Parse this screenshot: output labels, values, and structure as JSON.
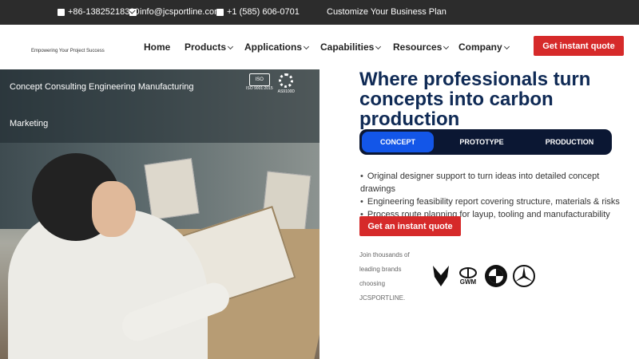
{
  "topbar": {
    "phone1": "+86-13825218330",
    "email": "info@jcsportline.com",
    "phone2": "+1 (585) 606-0701",
    "cta": "Customize Your Business Plan"
  },
  "nav": {
    "tagline": "Empowering Your Project Success",
    "items": [
      {
        "label": "Home",
        "dropdown": false
      },
      {
        "label": "Products",
        "dropdown": true
      },
      {
        "label": "Applications",
        "dropdown": true
      },
      {
        "label": "Capabilities",
        "dropdown": true
      },
      {
        "label": "Resources",
        "dropdown": true
      },
      {
        "label": "Company",
        "dropdown": true
      }
    ],
    "quote_label": "Get instant quote"
  },
  "hero_image": {
    "caption_line1": "Concept Consulting Engineering Manufacturing",
    "caption_line2": "Marketing",
    "badge_iso": "ISO 9001:2015",
    "badge_as": "AS9100D",
    "badge_iso_icon_text": "ISO"
  },
  "main": {
    "headline": "Where professionals turn concepts into carbon production",
    "tabs": [
      {
        "label": "CONCEPT",
        "active": true
      },
      {
        "label": "PROTOTYPE",
        "active": false
      },
      {
        "label": "PRODUCTION",
        "active": false
      }
    ],
    "bullets": [
      "Original designer support to turn ideas into detailed concept drawings",
      "Engineering feasibility report covering structure, materials & risks",
      "Process route planning for layup, tooling and manufacturability"
    ],
    "quote_label": "Get an instant quote",
    "join_text": "Join thousands of leading brands choosing JCSPORTLINE.",
    "brands": [
      "lamborghini-icon",
      "gwm-icon",
      "bmw-icon",
      "mercedes-icon"
    ],
    "brand_gwm_text": "GWM"
  },
  "colors": {
    "topbar_bg": "#2c2c2c",
    "accent_red": "#d62a2a",
    "navy": "#0f2a55",
    "tab_active": "#1356e8",
    "tab_bg": "#0b1733"
  }
}
